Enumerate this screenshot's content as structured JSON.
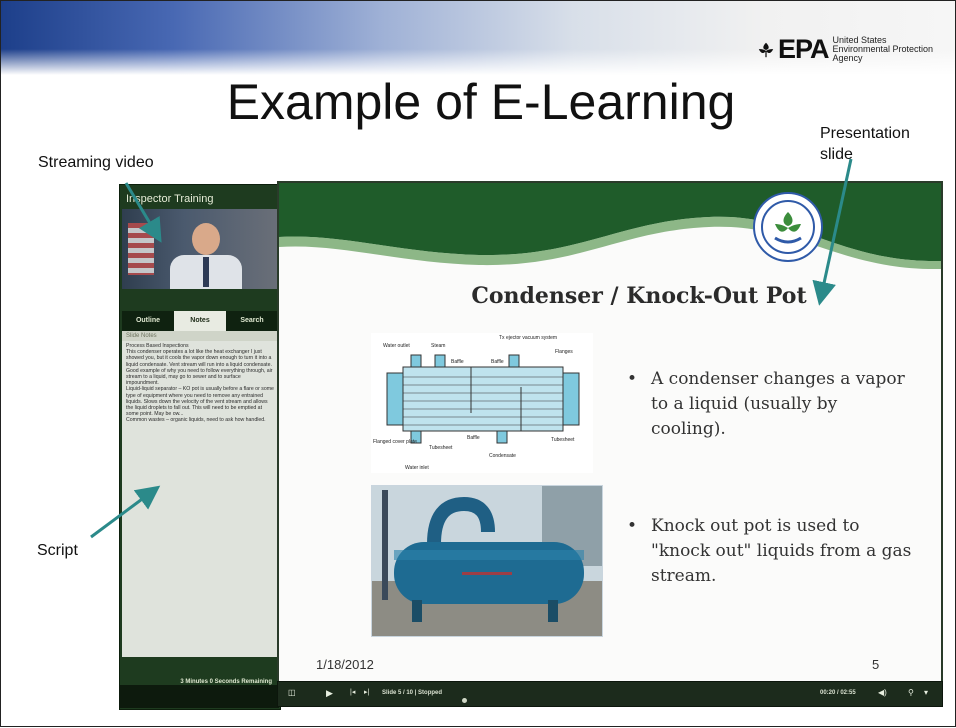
{
  "page": {
    "title": "Example of E-Learning",
    "epa_logo_text": "EPA",
    "epa_agency_text": "United States\nEnvironmental Protection\nAgency"
  },
  "annotations": {
    "streaming_video": "Streaming video",
    "presentation_slide": "Presentation\nslide",
    "script": "Script"
  },
  "lms": {
    "course_title": "Inspector Training",
    "tabs": [
      {
        "label": "Outline",
        "active": false
      },
      {
        "label": "Notes",
        "active": true
      },
      {
        "label": "Search",
        "active": false
      }
    ],
    "notes_header": "Slide Notes",
    "notes_text": "Process Based Inspections\nThis condenser operates a lot like the heat exchanger I just showed you, but it cools the vapor down enough to turn it into a liquid condensate. Vent stream will run into a liquid condensate. Good example of why you need to follow everything through, air stream to a liquid, may go to sewer and to surface impoundment.\nLiquid-liquid separator – KO pot is usually before a flare or some type of equipment where you need to remove any entrained liquids. Slows down the velocity of the vent stream and allows the liquid droplets to fall out. This will need to be emptied at some point. May be ow...\nCommon wastes – organic liquids, need to ask how handled.",
    "time_remaining": "3 Minutes 0 Seconds Remaining"
  },
  "slide": {
    "heading": "Condenser / Knock-Out Pot",
    "diagram_labels": [
      "Water outlet",
      "Steam",
      "Tx ejector vacuum system",
      "Baffle",
      "Baffle",
      "Flanges",
      "Flanged cover plate",
      "Tubesheet",
      "Baffle",
      "Tubesheet",
      "Condensate",
      "Water inlet"
    ],
    "bullets": [
      "A condenser changes a vapor to a liquid (usually by cooling).",
      "Knock out pot is used to \"knock out\" liquids from a gas stream."
    ],
    "date": "1/18/2012",
    "slide_number": "5"
  },
  "player": {
    "slide_status": "Slide 5 / 10 | Stopped",
    "elapsed": "00:20 / 02:55"
  },
  "colors": {
    "lms_green": "#1e3b1f",
    "slide_wave_green": "#1f5c2a",
    "arrow_teal": "#2b8a8a"
  }
}
